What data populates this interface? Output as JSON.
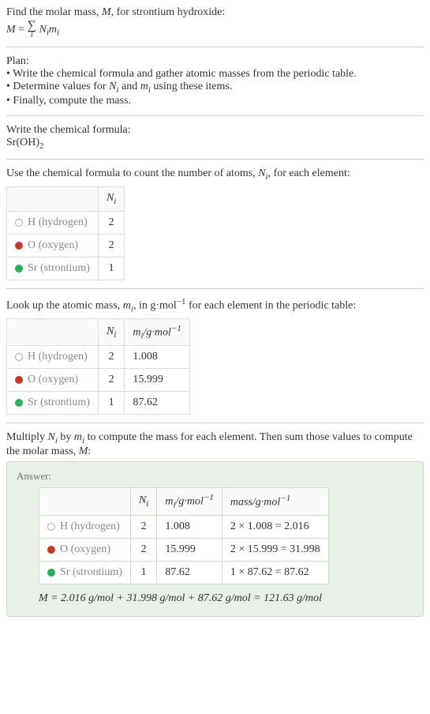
{
  "intro": {
    "line1_pre": "Find the molar mass, ",
    "line1_var": "M",
    "line1_post": ", for strontium hydroxide:",
    "eq_left": "M",
    "eq_sigma_under": "i",
    "eq_right_N": "N",
    "eq_right_Ni": "i",
    "eq_right_m": "m",
    "eq_right_mi": "i"
  },
  "plan": {
    "title": "Plan:",
    "item1": "Write the chemical formula and gather atomic masses from the periodic table.",
    "item2_pre": "Determine values for ",
    "item2_N": "N",
    "item2_Ni": "i",
    "item2_mid": " and ",
    "item2_m": "m",
    "item2_mi": "i",
    "item2_post": " using these items.",
    "item3": "Finally, compute the mass."
  },
  "stepA": {
    "title": "Write the chemical formula:",
    "formula_main": "Sr(OH)",
    "formula_sub": "2"
  },
  "stepB": {
    "text_pre": "Use the chemical formula to count the number of atoms, ",
    "text_N": "N",
    "text_Ni": "i",
    "text_post": ", for each element:"
  },
  "table1": {
    "header_N": "N",
    "header_Ni": "i",
    "rows": [
      {
        "label": "H (hydrogen)",
        "dot": "dot-h",
        "n": "2"
      },
      {
        "label": "O (oxygen)",
        "dot": "dot-o",
        "n": "2"
      },
      {
        "label": "Sr (strontium)",
        "dot": "dot-sr",
        "n": "1"
      }
    ]
  },
  "stepC": {
    "text_pre": "Look up the atomic mass, ",
    "text_m": "m",
    "text_mi": "i",
    "text_mid": ", in g·mol",
    "text_exp": "−1",
    "text_post": " for each element in the periodic table:"
  },
  "table2": {
    "header_N": "N",
    "header_Ni": "i",
    "header_m": "m",
    "header_mi": "i",
    "header_unit_pre": "/g·mol",
    "header_unit_exp": "−1",
    "rows": [
      {
        "label": "H (hydrogen)",
        "dot": "dot-h",
        "n": "2",
        "m": "1.008"
      },
      {
        "label": "O (oxygen)",
        "dot": "dot-o",
        "n": "2",
        "m": "15.999"
      },
      {
        "label": "Sr (strontium)",
        "dot": "dot-sr",
        "n": "1",
        "m": "87.62"
      }
    ]
  },
  "stepD": {
    "text_pre": "Multiply ",
    "text_N": "N",
    "text_Ni": "i",
    "text_by": " by ",
    "text_m": "m",
    "text_mi": "i",
    "text_mid": " to compute the mass for each element. Then sum those values to compute the molar mass, ",
    "text_M": "M",
    "text_post": ":"
  },
  "answer": {
    "label": "Answer:",
    "header_N": "N",
    "header_Ni": "i",
    "header_m": "m",
    "header_mi": "i",
    "header_unit_pre": "/g·mol",
    "header_unit_exp": "−1",
    "header_mass_pre": "mass/g·mol",
    "header_mass_exp": "−1",
    "rows": [
      {
        "label": "H (hydrogen)",
        "dot": "dot-h",
        "n": "2",
        "m": "1.008",
        "mass": "2 × 1.008 = 2.016"
      },
      {
        "label": "O (oxygen)",
        "dot": "dot-o",
        "n": "2",
        "m": "15.999",
        "mass": "2 × 15.999 = 31.998"
      },
      {
        "label": "Sr (strontium)",
        "dot": "dot-sr",
        "n": "1",
        "m": "87.62",
        "mass": "1 × 87.62 = 87.62"
      }
    ],
    "final_M": "M",
    "final_eq": " = 2.016 g/mol + 31.998 g/mol + 87.62 g/mol = 121.63 g/mol"
  }
}
